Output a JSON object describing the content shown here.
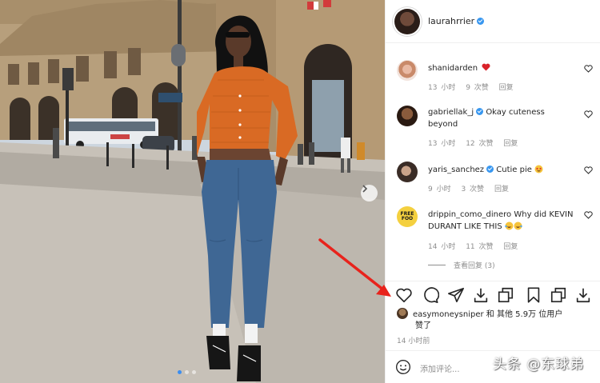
{
  "post": {
    "username": "laurahrrier",
    "verified": true
  },
  "comments": [
    {
      "user": "shanidarden",
      "text": "",
      "emoji": "red-heart",
      "time": "13 小时",
      "likes": "9 次赞",
      "reply": "回复"
    },
    {
      "user": "gabriellak_j",
      "verified": true,
      "text": "Okay cuteness beyond",
      "time": "13 小时",
      "likes": "12 次赞",
      "reply": "回复"
    },
    {
      "user": "yaris_sanchez",
      "verified": true,
      "text": "Cutie pie",
      "emoji": "star-struck",
      "time": "9 小时",
      "likes": "3 次赞",
      "reply": "回复"
    },
    {
      "user": "drippin_como_dinero",
      "text": "Why did KEVIN DURANT LIKE THIS",
      "emoji": "laughing-tears",
      "time": "14 小时",
      "likes": "11 次赞",
      "reply": "回复"
    }
  ],
  "view_replies": "查看回复 (3)",
  "commenter_avatar_label": "FREE FOO",
  "likes": {
    "user": "easymoneysniper",
    "text_1": " 和 ",
    "others": "其他 5.9万 位用户",
    "text_2": "赞了"
  },
  "time_ago": "14 小时前",
  "add_comment_placeholder": "添加评论...",
  "watermark": "头条 @东球弟",
  "icons": {
    "like": "heart-icon",
    "comment": "comment-icon",
    "share": "send-icon",
    "download": "download-icon",
    "copy": "copy-icon",
    "save": "bookmark-icon"
  },
  "colors": {
    "verified": "#3897f0",
    "annotation_arrow": "#e8231c",
    "muted_text": "#8e8e8e"
  }
}
